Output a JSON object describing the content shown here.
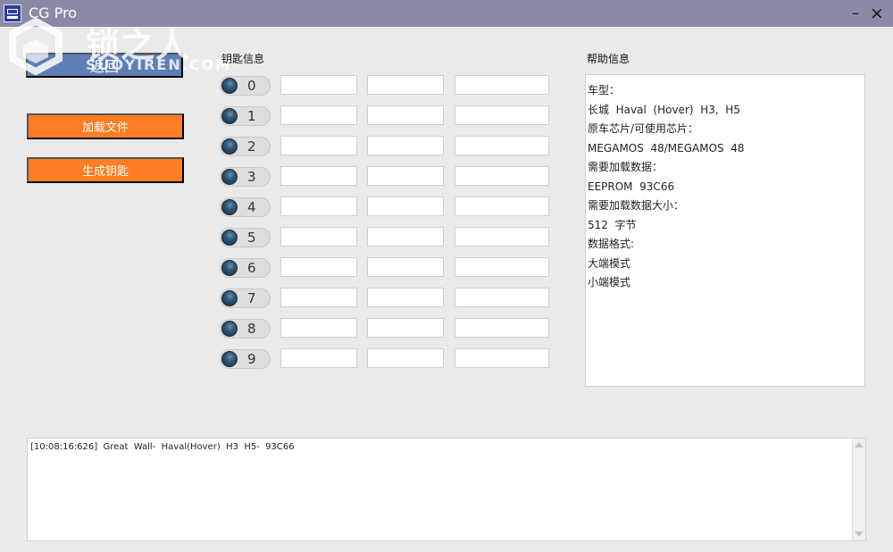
{
  "window": {
    "title": "CG Pro",
    "controls": {
      "minimize": "–",
      "close": "×"
    }
  },
  "watermark": {
    "text": "锁之人",
    "subtext": "SUOYIREN.COM",
    "icon": "cube-logo"
  },
  "sidebar": {
    "back_button": "返回",
    "load_file_button": "加载文件",
    "generate_key_button": "生成钥匙"
  },
  "key_info": {
    "label": "钥匙信息",
    "rows": [
      {
        "number": "0",
        "values": [
          "",
          "",
          ""
        ]
      },
      {
        "number": "1",
        "values": [
          "",
          "",
          ""
        ]
      },
      {
        "number": "2",
        "values": [
          "",
          "",
          ""
        ]
      },
      {
        "number": "3",
        "values": [
          "",
          "",
          ""
        ]
      },
      {
        "number": "4",
        "values": [
          "",
          "",
          ""
        ]
      },
      {
        "number": "5",
        "values": [
          "",
          "",
          ""
        ]
      },
      {
        "number": "6",
        "values": [
          "",
          "",
          ""
        ]
      },
      {
        "number": "7",
        "values": [
          "",
          "",
          ""
        ]
      },
      {
        "number": "8",
        "values": [
          "",
          "",
          ""
        ]
      },
      {
        "number": "9",
        "values": [
          "",
          "",
          ""
        ]
      }
    ]
  },
  "help": {
    "label": "帮助信息",
    "lines": [
      "车型：",
      "长城  Haval  (Hover)  H3,  H5",
      "原车芯片/可使用芯片：",
      "MEGAMOS  48/MEGAMOS  48",
      "需要加载数据：",
      "EEPROM  93C66",
      "需要加载数据大小：",
      "512  字节",
      "数据格式:",
      "大端模式",
      "小端模式"
    ]
  },
  "log": {
    "lines": [
      "[10:08:16:626]  Great  Wall-  Haval(Hover)  H3  H5-  93C66"
    ]
  },
  "colors": {
    "titlebar": "#8a8aa6",
    "back_button": "#5f7fb4",
    "orange_button": "#ff7d25",
    "background": "#eaeaea"
  }
}
